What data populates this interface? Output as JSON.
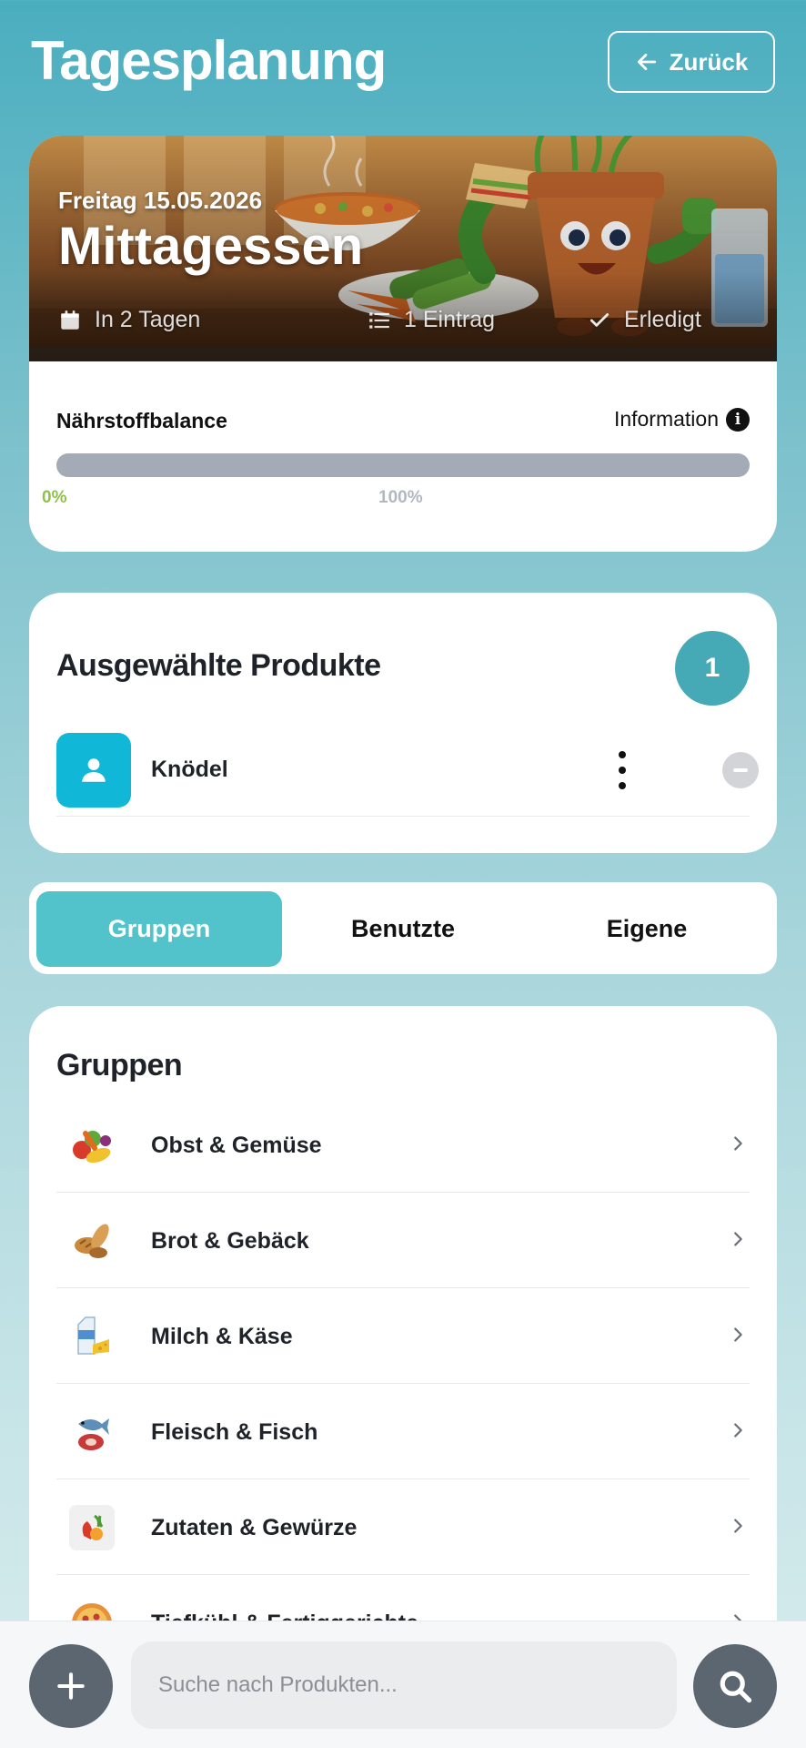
{
  "header": {
    "title": "Tagesplanung",
    "back_label": "Zurück"
  },
  "hero": {
    "date": "Freitag 15.05.2026",
    "meal": "Mittagessen",
    "meta": {
      "days": "In 2 Tagen",
      "entries": "1 Eintrag",
      "status": "Erledigt"
    }
  },
  "nutrient": {
    "label": "Nährstoffbalance",
    "info_label": "Information",
    "min_label": "0%",
    "max_label": "100%",
    "progress": 0,
    "colors": {
      "track": "#a4aab6",
      "low": "#8dc14a"
    }
  },
  "selected": {
    "title": "Ausgewählte Produkte",
    "count": "1",
    "items": [
      {
        "name": "Knödel",
        "icon": "person-icon"
      }
    ]
  },
  "tabs": [
    {
      "label": "Gruppen",
      "active": true
    },
    {
      "label": "Benutzte",
      "active": false
    },
    {
      "label": "Eigene",
      "active": false
    }
  ],
  "groups": {
    "title": "Gruppen",
    "items": [
      {
        "label": "Obst & Gemüse",
        "icon": "fruit-vegetable-icon"
      },
      {
        "label": "Brot & Gebäck",
        "icon": "bread-icon"
      },
      {
        "label": "Milch & Käse",
        "icon": "milk-cheese-icon"
      },
      {
        "label": "Fleisch & Fisch",
        "icon": "meat-fish-icon"
      },
      {
        "label": "Zutaten & Gewürze",
        "icon": "spices-icon"
      },
      {
        "label": "Tiefkühl & Fertiggerichte",
        "icon": "pizza-icon"
      }
    ]
  },
  "search": {
    "placeholder": "Suche nach Produkten..."
  },
  "theme": {
    "accent": "#52c3cb",
    "badge": "#46a9b6",
    "avatar": "#10b7d6",
    "fab": "#5c6670"
  }
}
